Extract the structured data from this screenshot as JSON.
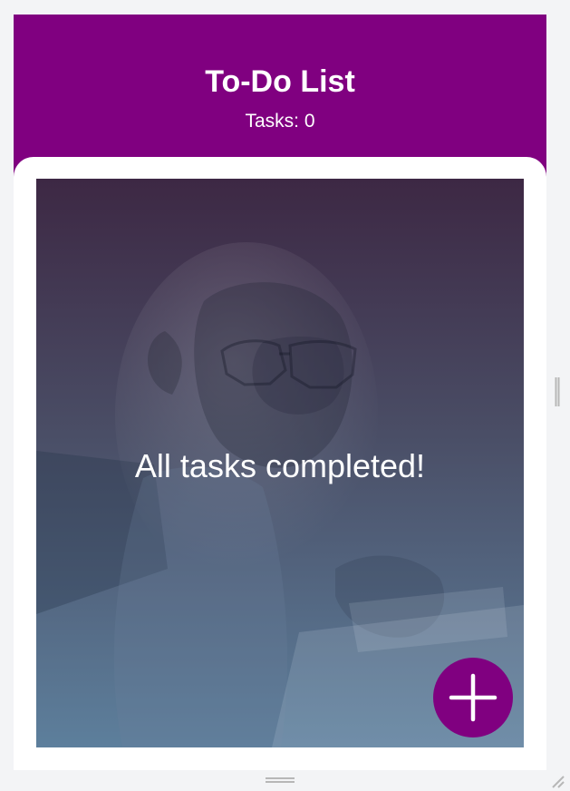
{
  "header": {
    "title": "To-Do List",
    "task_count": "Tasks: 0"
  },
  "empty_state": {
    "message": "All tasks completed!",
    "background_image": "chimpanzee-with-glasses-at-laptop"
  },
  "fab": {
    "icon": "plus-icon"
  },
  "colors": {
    "accent": "#800080",
    "header_text": "#ffffff",
    "gradient_top": "#3d2844",
    "gradient_bottom": "#5d7f9c",
    "page_background": "#f3f4f6"
  },
  "chrome": {
    "scrollbar_icon": "scrollbar-handle-icon",
    "bottom_icon": "drag-handle-icon",
    "resize_icon": "resize-grip-icon"
  }
}
